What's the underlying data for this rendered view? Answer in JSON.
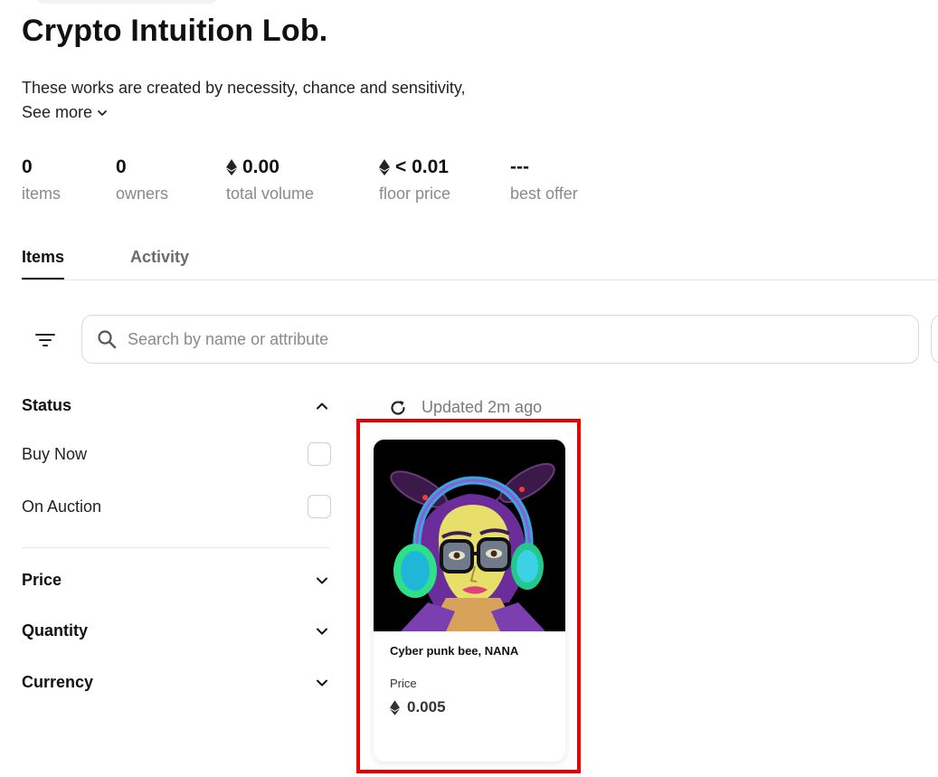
{
  "collection": {
    "title": "Crypto Intuition Lob.",
    "description": "These works are created by necessity, chance and sensitivity,",
    "see_more": "See more"
  },
  "stats": [
    {
      "value": "0",
      "label": "items"
    },
    {
      "value": "0",
      "label": "owners"
    },
    {
      "value": "0.00",
      "label": "total volume"
    },
    {
      "value": "< 0.01",
      "label": "floor price"
    },
    {
      "value": "---",
      "label": "best offer"
    }
  ],
  "tabs": [
    {
      "label": "Items",
      "active": true
    },
    {
      "label": "Activity",
      "active": false
    }
  ],
  "search": {
    "placeholder": "Search by name or attribute"
  },
  "filters": {
    "status": {
      "label": "Status",
      "options": [
        {
          "label": "Buy Now",
          "checked": false
        },
        {
          "label": "On Auction",
          "checked": false
        }
      ]
    },
    "price": {
      "label": "Price"
    },
    "quantity": {
      "label": "Quantity"
    },
    "currency": {
      "label": "Currency"
    }
  },
  "updated": "Updated 2m ago",
  "items": [
    {
      "name": "Cyber punk bee, NANA",
      "price_label": "Price",
      "price": "0.005"
    }
  ],
  "colors": {
    "highlight": "#e60000",
    "muted": "#8a8a8a",
    "text": "#111111"
  }
}
